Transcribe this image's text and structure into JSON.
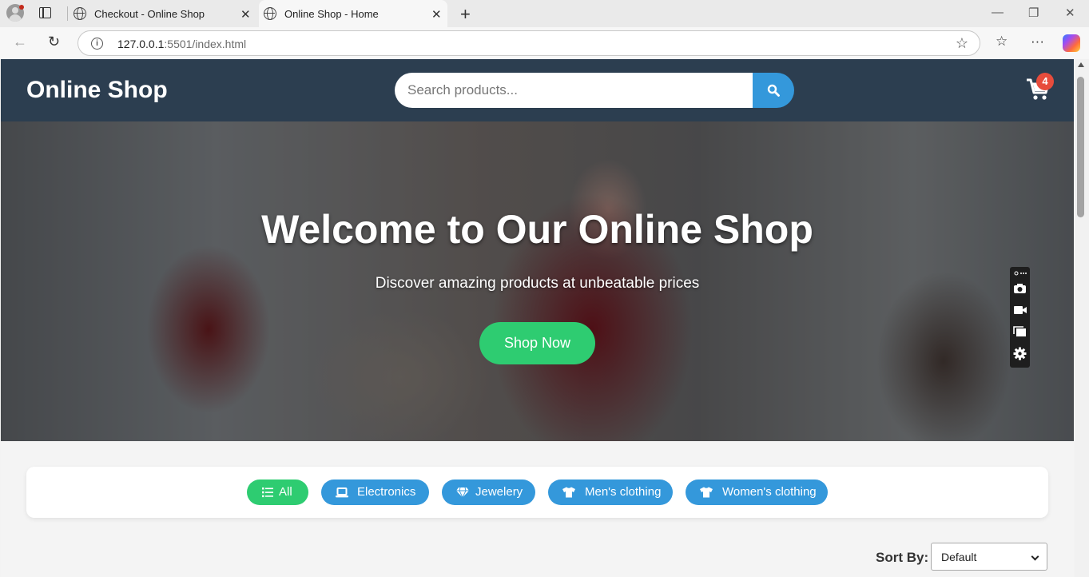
{
  "browser": {
    "tabs": [
      {
        "title": "Checkout - Online Shop",
        "active": false
      },
      {
        "title": "Online Shop - Home",
        "active": true
      }
    ],
    "url_host": "127.0.0.1",
    "url_rest": ":5501/index.html"
  },
  "header": {
    "logo": "Online Shop",
    "search_placeholder": "Search products...",
    "cart_count": "4"
  },
  "hero": {
    "title": "Welcome to Our Online Shop",
    "subtitle": "Discover amazing products at unbeatable prices",
    "cta": "Shop Now"
  },
  "categories": [
    {
      "label": "All",
      "icon": "list-icon",
      "active": true
    },
    {
      "label": "Electronics",
      "icon": "laptop-icon",
      "active": false
    },
    {
      "label": "Jewelery",
      "icon": "gem-icon",
      "active": false
    },
    {
      "label": "Men's clothing",
      "icon": "shirt-icon",
      "active": false
    },
    {
      "label": "Women's clothing",
      "icon": "shirt-icon",
      "active": false
    }
  ],
  "sort": {
    "label": "Sort By:",
    "selected": "Default"
  },
  "colors": {
    "header": "#2c3e50",
    "primary": "#3498db",
    "accent": "#2ecc71",
    "badge": "#e74c3c"
  }
}
